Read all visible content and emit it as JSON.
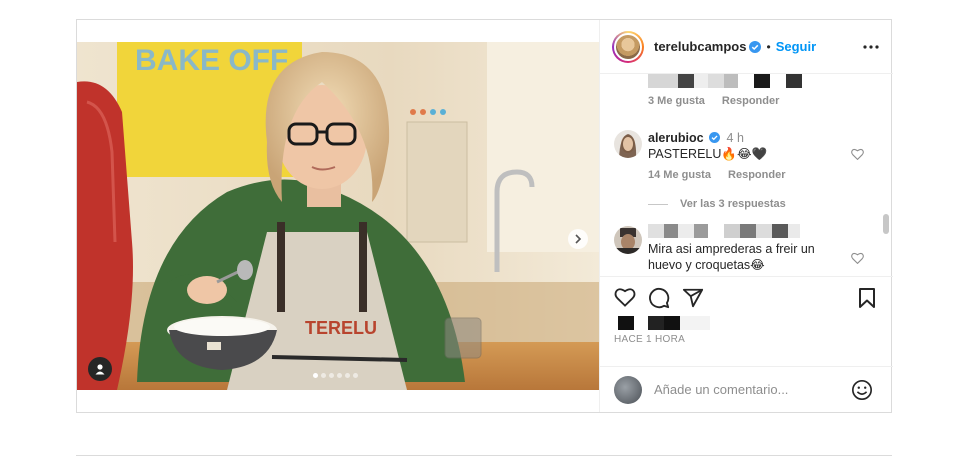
{
  "post": {
    "username": "terelubcampos",
    "verified": true,
    "separator": "•",
    "follow_label": "Seguir",
    "more_icon": "more-horizontal-icon",
    "carousel": {
      "total": 6,
      "active": 1
    },
    "time_ago": "HACE 1 HORA",
    "photo_sign_text": "BAKE OFF",
    "apron_text": "TERELU"
  },
  "comments": [
    {
      "username_hidden": true,
      "likes": "3 Me gusta",
      "reply_label": "Responder"
    },
    {
      "username": "alerubioc",
      "verified": true,
      "time": "4 h",
      "text": "PASTERELU🔥😂🖤",
      "likes": "14 Me gusta",
      "reply_label": "Responder",
      "view_replies": "Ver las 3 respuestas"
    },
    {
      "username_hidden": true,
      "text_line1": "Mira asi amprederas a freir un",
      "text_line2": "huevo y croquetas😂"
    }
  ],
  "actions": {
    "like_icon": "heart-icon",
    "comment_icon": "comment-icon",
    "share_icon": "share-icon",
    "save_icon": "bookmark-icon"
  },
  "add_comment": {
    "placeholder": "Añade un comentario...",
    "emoji_icon": "emoji-icon"
  },
  "colors": {
    "link_blue": "#0095f6",
    "muted_text": "#8e8e8e",
    "border": "#dbdbdb"
  }
}
